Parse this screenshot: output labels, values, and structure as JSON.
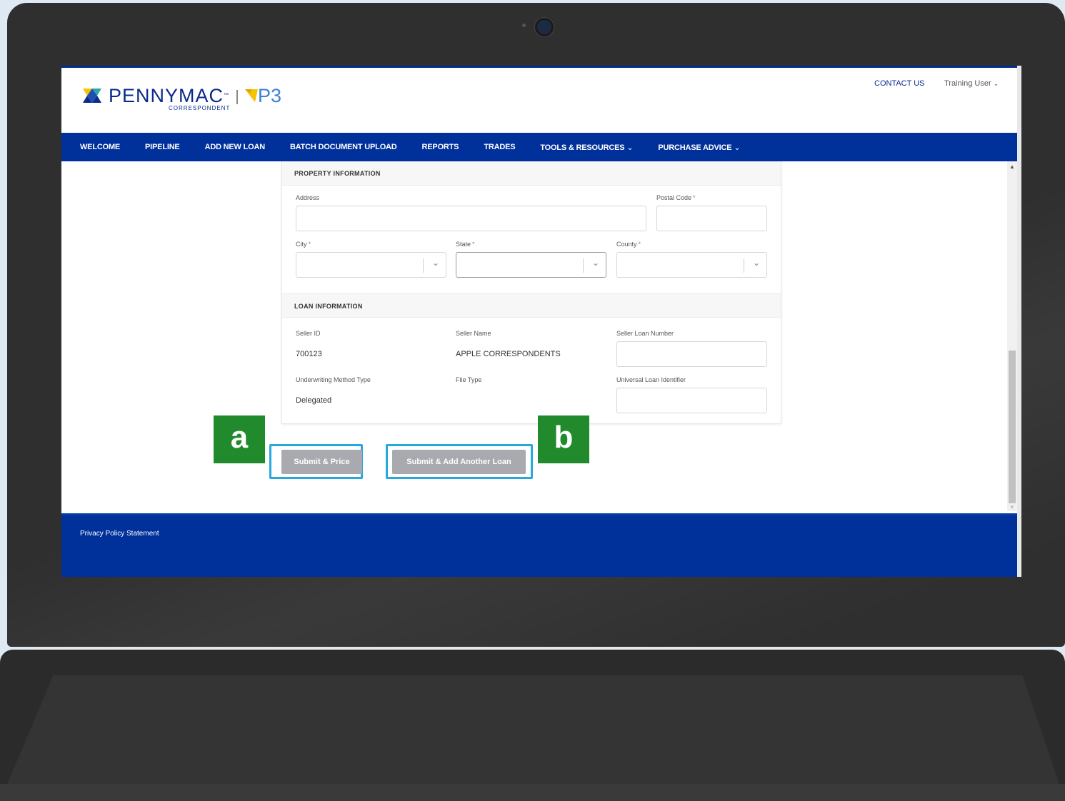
{
  "header": {
    "brand": "PENNYMAC",
    "brand_tm": "™",
    "brand_sub": "CORRESPONDENT",
    "product": "P3",
    "contact_label": "CONTACT US",
    "user_label": "Training User",
    "brand_colors": {
      "navy": "#00309a",
      "yellow": "#f5c400",
      "teal": "#2aa6a6",
      "p3_blue": "#3a7fd6"
    }
  },
  "nav": {
    "items": [
      {
        "label": "WELCOME",
        "dropdown": false
      },
      {
        "label": "PIPELINE",
        "dropdown": false
      },
      {
        "label": "ADD NEW LOAN",
        "dropdown": false
      },
      {
        "label": "BATCH DOCUMENT UPLOAD",
        "dropdown": false
      },
      {
        "label": "REPORTS",
        "dropdown": false
      },
      {
        "label": "TRADES",
        "dropdown": false
      },
      {
        "label": "TOOLS & RESOURCES",
        "dropdown": true
      },
      {
        "label": "PURCHASE ADVICE",
        "dropdown": true
      }
    ]
  },
  "property": {
    "section_title": "PROPERTY INFORMATION",
    "address_label": "Address",
    "postal_label": "Postal Code",
    "city_label": "City",
    "state_label": "State",
    "county_label": "County",
    "required_mark": "*"
  },
  "loan": {
    "section_title": "LOAN INFORMATION",
    "seller_id_label": "Seller ID",
    "seller_id": "700123",
    "seller_name_label": "Seller Name",
    "seller_name": "APPLE CORRESPONDENTS",
    "seller_loan_label": "Seller Loan Number",
    "uw_label": "Underwriting Method Type",
    "uw_value": "Delegated",
    "file_type_label": "File Type",
    "uli_label": "Universal Loan Identifier"
  },
  "actions": {
    "submit_price": "Submit & Price",
    "submit_add": "Submit & Add Another Loan",
    "callout_a": "a",
    "callout_b": "b",
    "highlight_color": "#27a8de",
    "callout_color": "#218a2c"
  },
  "footer": {
    "privacy": "Privacy Policy Statement"
  }
}
